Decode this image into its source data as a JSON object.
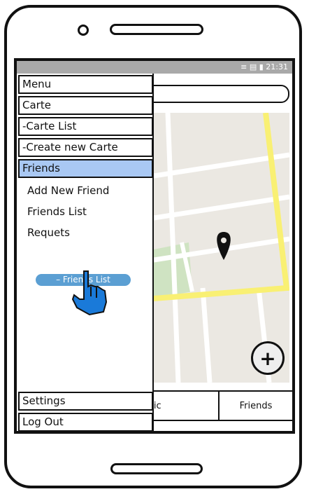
{
  "status_bar": {
    "time": "21:31"
  },
  "menu": {
    "header": "Menu",
    "items": [
      {
        "label": "Carte"
      },
      {
        "label": "-Carte List"
      },
      {
        "label": "-Create new Carte"
      },
      {
        "label": "Friends"
      }
    ],
    "friends_sub": [
      {
        "label": "Add New Friend"
      },
      {
        "label": "Friends List"
      },
      {
        "label": "Requets"
      }
    ],
    "tooltip": "– Friends List",
    "settings": "Settings",
    "logout": "Log Out"
  },
  "tabs": [
    {
      "label": "blic"
    },
    {
      "label": "Friends"
    }
  ],
  "fab": {
    "symbol": "+"
  },
  "colors": {
    "active_item": "#a9c8f3",
    "map_road": "#ffffff",
    "map_highway": "#f9f073",
    "map_park": "#cfe3c2",
    "tooltip_bg": "#5b9fd3"
  }
}
